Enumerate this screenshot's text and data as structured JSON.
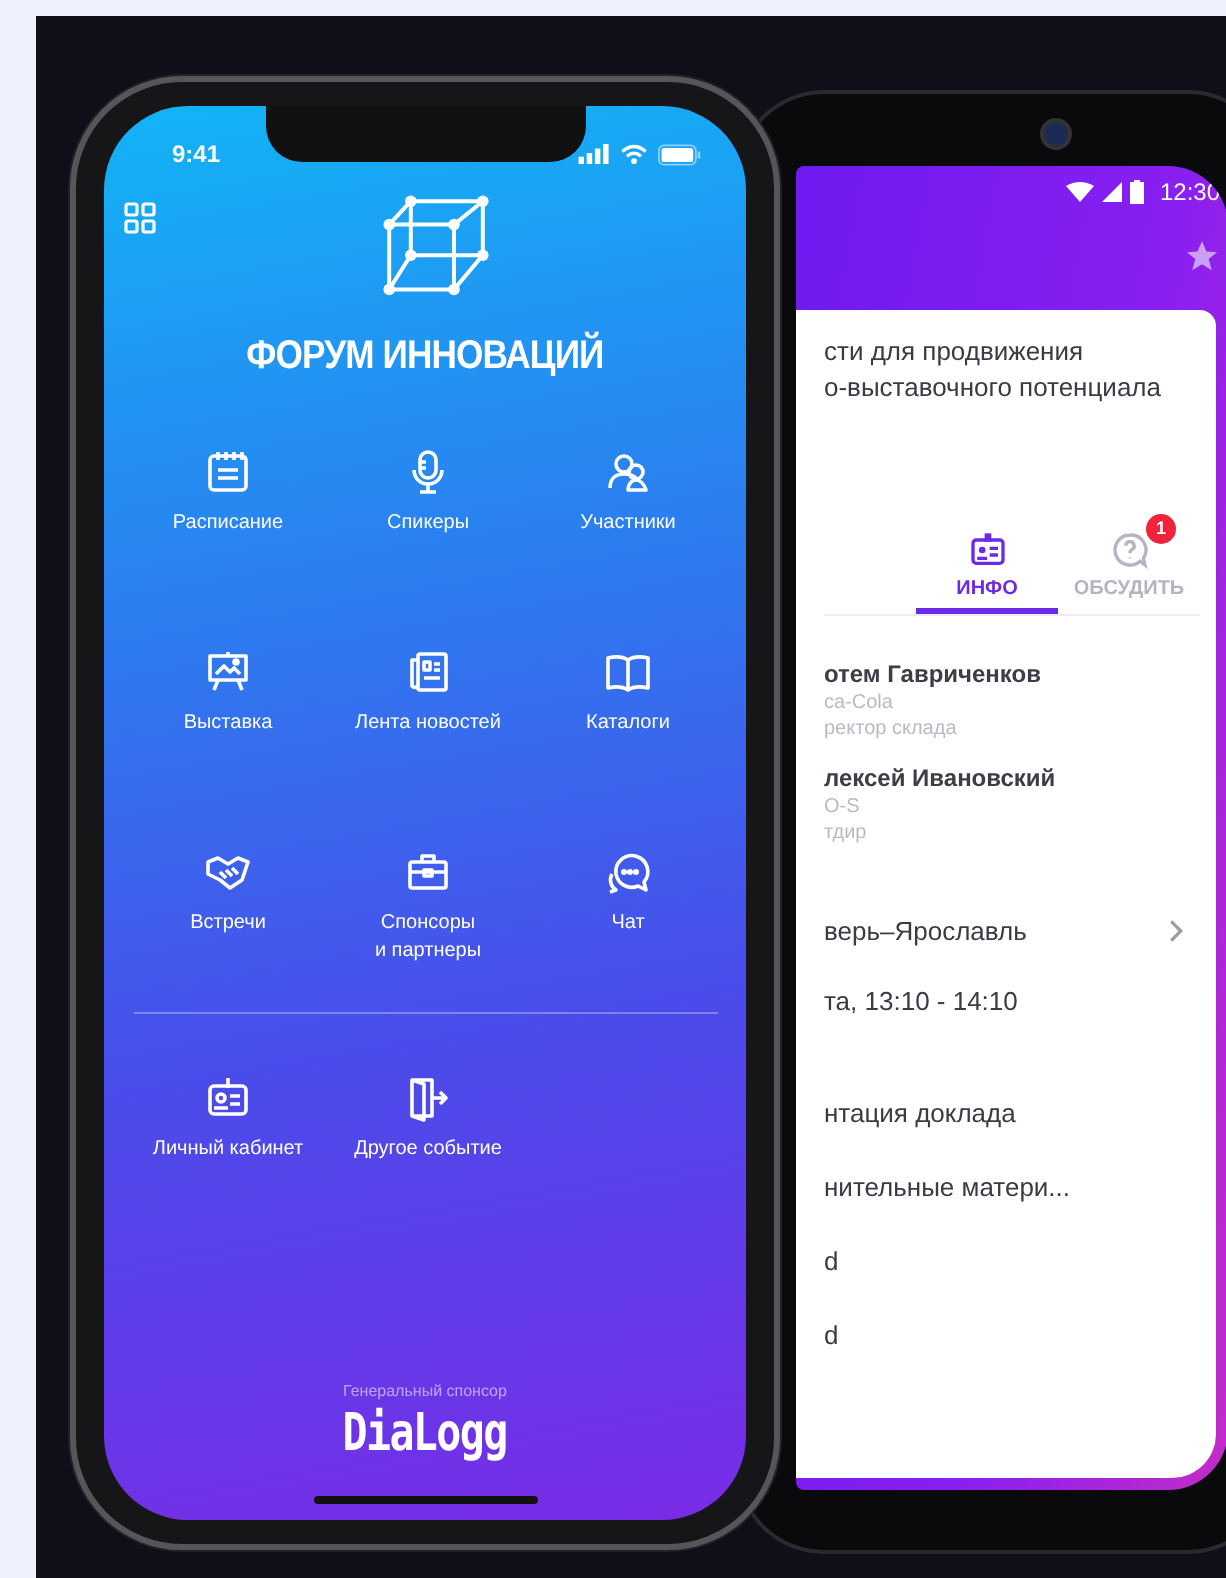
{
  "phone_1": {
    "status_bar": {
      "time": "9:41"
    },
    "app_title": "ФОРУМ ИННОВАЦИЙ",
    "menu": [
      {
        "label": "Расписание",
        "kind": "calendar"
      },
      {
        "label": "Спикеры",
        "kind": "microphone"
      },
      {
        "label": "Участники",
        "kind": "people"
      },
      {
        "label": "Выставка",
        "kind": "easel"
      },
      {
        "label": "Лента новостей",
        "kind": "newspaper"
      },
      {
        "label": "Каталоги",
        "kind": "book"
      },
      {
        "label": "Встречи",
        "kind": "handshake"
      },
      {
        "label": "Спонсоры и партнеры",
        "kind": "briefcase"
      },
      {
        "label": "Чат",
        "kind": "chat"
      }
    ],
    "account_menu": [
      {
        "label": "Личный кабинет",
        "kind": "badge"
      },
      {
        "label": "Другое событие",
        "kind": "door"
      }
    ],
    "sponsor": {
      "caption": "Генеральный спонсор",
      "name": "DiaLogg"
    }
  },
  "phone_2": {
    "status_bar": {
      "time": "12:30"
    },
    "title_lines": [
      "сти для продвижения",
      "о-выставочного потенциала"
    ],
    "tabs": [
      {
        "label": "ИНФО",
        "selected": true
      },
      {
        "label": "ОБСУДИТЬ",
        "selected": false,
        "badge": "1"
      }
    ],
    "speakers": [
      {
        "name": "отем Гавриченков",
        "company": "ca-Cola",
        "role": "ректор склада"
      },
      {
        "name": "лексей Ивановский",
        "company": "O-S",
        "role": "тдир"
      }
    ],
    "route": "верь–Ярославль",
    "time": "та, 13:10 - 14:10",
    "materials": [
      "нтация доклада",
      "нительные матери...",
      "d",
      "d"
    ]
  }
}
